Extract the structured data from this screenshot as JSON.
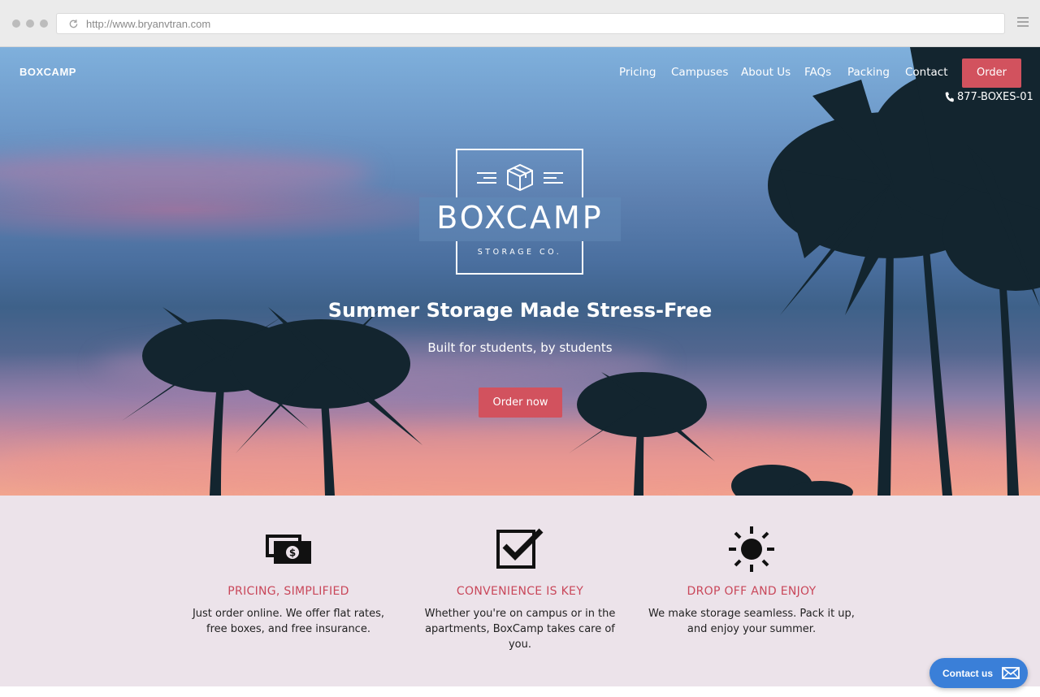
{
  "browser": {
    "url": "http://www.bryanvtran.com",
    "icons": [
      "reload-icon",
      "menu-icon"
    ]
  },
  "nav": {
    "brand": "BOXCAMP",
    "links": [
      "Pricing",
      "Campuses",
      "About Us",
      "FAQs",
      "Packing",
      "Contact"
    ],
    "order_label": "Order",
    "phone": "877-BOXES-01"
  },
  "hero": {
    "logo_word": "BOXCAMP",
    "logo_sub": "STORAGE CO.",
    "headline": "Summer Storage Made Stress-Free",
    "subline": "Built for students, by students",
    "cta_label": "Order now"
  },
  "features": [
    {
      "icon": "money-icon",
      "title": "PRICING, SIMPLIFIED",
      "text": "Just order online. We offer flat rates, free boxes, and free insurance."
    },
    {
      "icon": "checkbox-icon",
      "title": "CONVENIENCE IS KEY",
      "text": "Whether you're on campus or in the apartments, BoxCamp takes care of you."
    },
    {
      "icon": "sun-icon",
      "title": "DROP OFF AND ENJOY",
      "text": "We make storage seamless. Pack it up, and enjoy your summer."
    }
  ],
  "contact_widget": {
    "label": "Contact us"
  },
  "colors": {
    "accent": "#d2525e",
    "feature_title": "#c9475a",
    "feature_bg": "#ece3ea",
    "contact_button": "#3a7fd8"
  }
}
